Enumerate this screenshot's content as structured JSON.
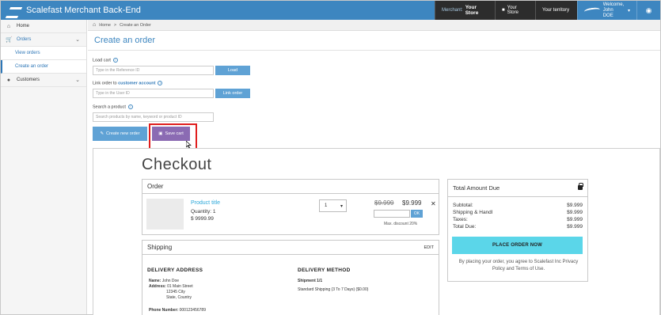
{
  "topbar": {
    "brand": "Scalefast Merchant Back-End",
    "merchant_label": "Merchant:",
    "merchant_value": "Your Store",
    "your_store": "Your Store",
    "territory": "Your territory",
    "welcome": "Welcome,",
    "user_name": "John DOE"
  },
  "sidebar": {
    "home": "Home",
    "orders": "Orders",
    "view_orders": "View orders",
    "create_order": "Create an order",
    "customers": "Customers"
  },
  "breadcrumb": {
    "home": "Home",
    "sep": ">",
    "current": "Create an Order"
  },
  "page_title": "Create an order",
  "form": {
    "load_cart_label": "Load cart",
    "load_cart_placeholder": "Type in the Reference ID",
    "load_button": "Load",
    "link_label_prefix": "Link order to",
    "link_label_link": "customer account",
    "link_placeholder": "Type in the User ID",
    "link_button": "Link order",
    "search_label": "Search a product",
    "search_placeholder": "Search products by name, keyword or product ID",
    "create_button": "Create new order",
    "save_button": "Save cart"
  },
  "checkout": {
    "title": "Checkout",
    "order_heading": "Order",
    "product_title": "Product title",
    "quantity": "Quantity: 1",
    "unit_price": "$ 9999.99",
    "qty_select": "1",
    "price_old": "$9.999",
    "price_new": "$9.999",
    "ok": "OK",
    "max_discount": "Max. discount 20%",
    "shipping_heading": "Shipping",
    "edit": "EDIT",
    "delivery_address_heading": "DELIVERY ADDRESS",
    "name_label": "Name:",
    "name_value": "John Doe",
    "address_label": "Address:",
    "address_line1": "01 Main Street",
    "address_line2": "12345 City",
    "address_line3": "State, Country",
    "phone_label": "Phone Number:",
    "phone_value": "000123456789",
    "delivery_method_heading": "DELIVERY METHOD",
    "shipment_label": "Shipment 1/1",
    "shipment_value": "Standard Shipping (3 To 7 Days) ($0.00)"
  },
  "totals": {
    "heading": "Total Amount Due",
    "rows": [
      {
        "label": "Subtotal:",
        "value": "$9.999"
      },
      {
        "label": "Shipping & Handl",
        "value": "$9.999"
      },
      {
        "label": "Taxes:",
        "value": "$9.999"
      },
      {
        "label": "Total Due:",
        "value": "$9.999"
      }
    ],
    "place_order": "PLACE ORDER NOW",
    "terms_prefix": "By placing your order, you agree to Scalefast Inc",
    "privacy": "Privacy Policy",
    "and": "and",
    "terms": "Terms of Use."
  },
  "colors": {
    "primary": "#3d86c0",
    "button": "#5fa2d5",
    "save": "#8b6bb3",
    "place_order": "#5bd6e9",
    "highlight": "#e01e1e"
  },
  "icons": {
    "home": "home-icon",
    "cart": "cart-icon",
    "users": "users-icon",
    "edit": "edit-icon",
    "floppy": "floppy-icon",
    "lock": "lock-icon",
    "globe": "globe-icon"
  }
}
